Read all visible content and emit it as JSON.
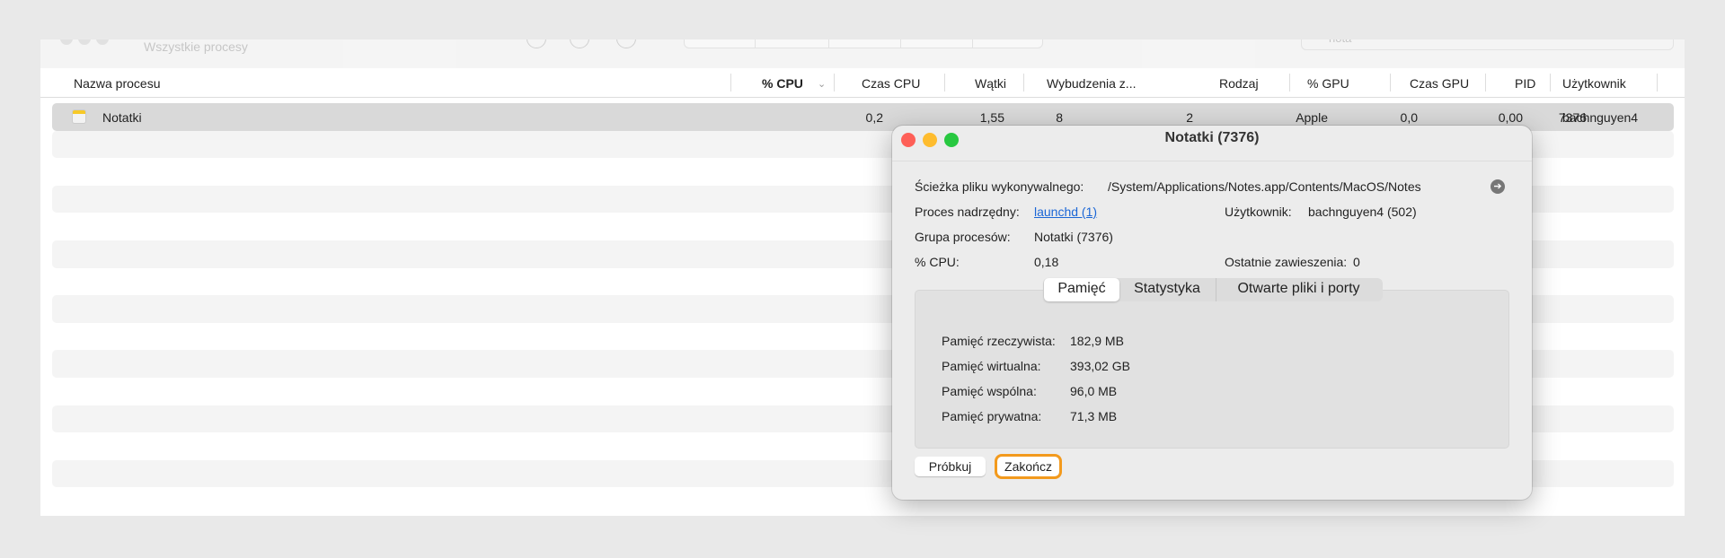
{
  "toolbar": {
    "title": "Wszystkie procesy",
    "search_value": "nota"
  },
  "table": {
    "columns": [
      "Nazwa procesu",
      "% CPU",
      "Czas CPU",
      "Wątki",
      "Wybudzenia z...",
      "Rodzaj",
      "% GPU",
      "Czas GPU",
      "PID",
      "Użytkownik"
    ],
    "sort_indicator": "⌄",
    "rows": [
      {
        "name": "Notatki",
        "cpu": "0,2",
        "cpu_time": "1,55",
        "threads": "8",
        "wakeups": "2",
        "kind": "Apple",
        "gpu": "0,0",
        "gpu_time": "0,00",
        "pid": "7376",
        "user": "bachnguyen4"
      }
    ]
  },
  "dialog": {
    "title": "Notatki (7376)",
    "path_label": "Ścieżka pliku wykonywalnego:",
    "path_value": "/System/Applications/Notes.app/Contents/MacOS/Notes",
    "parent_label": "Proces nadrzędny:",
    "parent_value": "launchd (1)",
    "user_label": "Użytkownik:",
    "user_value": "bachnguyen4 (502)",
    "group_label": "Grupa procesów:",
    "group_value": "Notatki (7376)",
    "cpu_label": "% CPU:",
    "cpu_value": "0,18",
    "hangs_label": "Ostatnie zawieszenia:",
    "hangs_value": "0",
    "tabs": [
      "Pamięć",
      "Statystyka",
      "Otwarte pliki i porty"
    ],
    "memory": [
      {
        "label": "Pamięć rzeczywista:",
        "value": "182,9 MB"
      },
      {
        "label": "Pamięć wirtualna:",
        "value": "393,02 GB"
      },
      {
        "label": "Pamięć wspólna:",
        "value": "96,0 MB"
      },
      {
        "label": "Pamięć prywatna:",
        "value": "71,3 MB"
      }
    ],
    "sample_button": "Próbkuj",
    "quit_button": "Zakończ"
  }
}
